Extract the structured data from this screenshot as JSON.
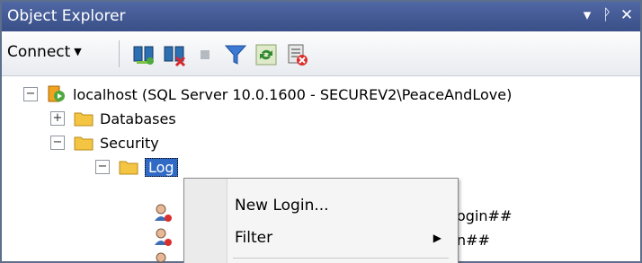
{
  "window": {
    "title": "Object Explorer",
    "pin_glyph": "▾ ꟼ",
    "close_glyph": "✕"
  },
  "toolbar": {
    "connect_label": "Connect",
    "connect_caret": "▼",
    "icons": [
      "connect-object-explorer-icon",
      "disconnect-icon",
      "stop-icon",
      "filter-icon",
      "refresh-icon",
      "activity-monitor-icon"
    ]
  },
  "tree": {
    "server": {
      "expander": "−",
      "label": "localhost (SQL Server 10.0.1600 - SECUREV2\\PeaceAndLove)"
    },
    "databases": {
      "expander": "+",
      "label": "Databases"
    },
    "security": {
      "expander": "−",
      "label": "Security"
    },
    "logins": {
      "expander": "−",
      "label": "Log"
    },
    "behind_items": [
      "ogin##",
      "n##"
    ]
  },
  "context_menu": {
    "items": [
      {
        "label": "New Login..."
      },
      {
        "label": "Filter",
        "submenu_arrow": "▶"
      }
    ]
  },
  "colors": {
    "titlebar": "#3a4f87",
    "selection": "#316ac5",
    "folder": "#f4c542"
  }
}
